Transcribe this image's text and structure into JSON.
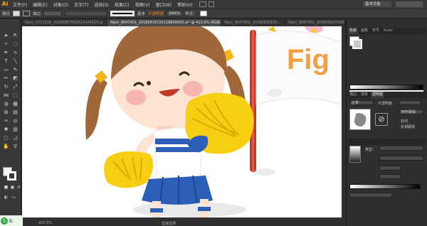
{
  "app": {
    "logo": "Ai"
  },
  "menu": [
    "文件(F)",
    "编辑(E)",
    "对象(O)",
    "文字(T)",
    "选择(S)",
    "效果(C)",
    "视图(V)",
    "窗口(W)",
    "帮助(H)"
  ],
  "workspace": "基本功能",
  "control": {
    "path_label": "路径",
    "stroke_label": "描边",
    "stroke_style": "基本",
    "opacity_label": "不透明度",
    "opacity_value": "100%",
    "style_label": "样式："
  },
  "tabs": [
    {
      "label": "Nipic_0711326_20180807092615424016.ai",
      "active": false
    },
    {
      "label": "Nipic_8047451_20180816150126800003.ai* @ 413.5% (RGB/预览)",
      "active": true
    },
    {
      "label": "Nipic_8047451_20180816150...",
      "active": false
    },
    {
      "label": "Nipic_9047451_20180816754652",
      "active": false
    }
  ],
  "canvas": {
    "flag_text": "Fig"
  },
  "statusbar": {
    "zoom": "413.5%",
    "tool": "直接选择"
  },
  "ime": {
    "logo": "S",
    "mode": "五"
  },
  "panels": {
    "swatch_tabs": [
      "色板",
      "画笔",
      "符号",
      "Kuler"
    ],
    "gradient_tabs": [
      "描边",
      "渐变",
      "透明度"
    ],
    "blend_mode": "正常",
    "opacity_label": "不透明度",
    "make_mask": "制作蒙版",
    "clip": "剪切",
    "invert": "反相蒙版",
    "appearance_label": "类型："
  },
  "colors": {
    "accent": "#f7a300",
    "hair": "#a0673a",
    "pompom": "#f6cf12",
    "jersey": "#2e5fb8",
    "pole": "#c9362b"
  }
}
